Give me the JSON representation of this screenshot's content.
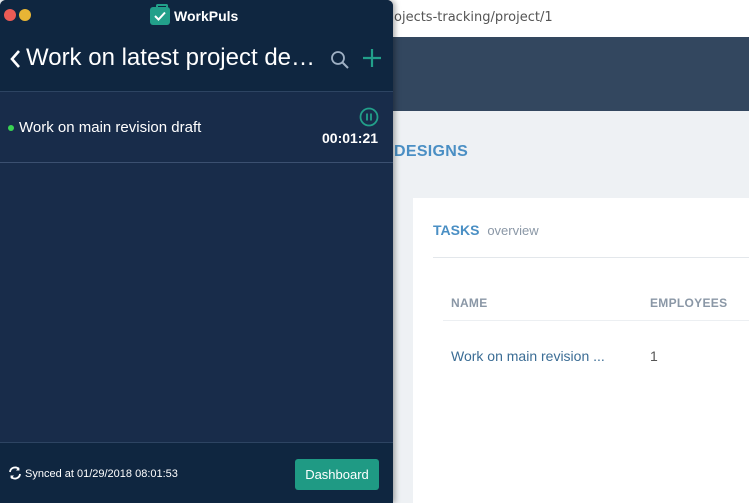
{
  "browser": {
    "url": "ojects-tracking/project/1"
  },
  "page": {
    "heading": "DESIGNS",
    "card": {
      "title": "TASKS",
      "subtitle": "overview",
      "columns": [
        "NAME",
        "EMPLOYEES"
      ],
      "rows": [
        {
          "name": "Work on main revision ...",
          "employees": "1"
        }
      ]
    }
  },
  "app": {
    "name": "WorkPuls",
    "header_title": "Work on latest project designs",
    "tasks": [
      {
        "name": "Work on main revision draft",
        "timer": "00:01:21",
        "status_color": "#39d353"
      }
    ],
    "footer": {
      "sync_text": "Synced at 01/29/2018 08:01:53",
      "dashboard_label": "Dashboard"
    },
    "colors": {
      "accent": "#1f9a84",
      "panel": "#182c4a",
      "bar": "#0f2640"
    },
    "icons": [
      "back-icon",
      "search-icon",
      "plus-icon",
      "pause-icon",
      "sync-icon",
      "briefcase-check-icon"
    ]
  }
}
